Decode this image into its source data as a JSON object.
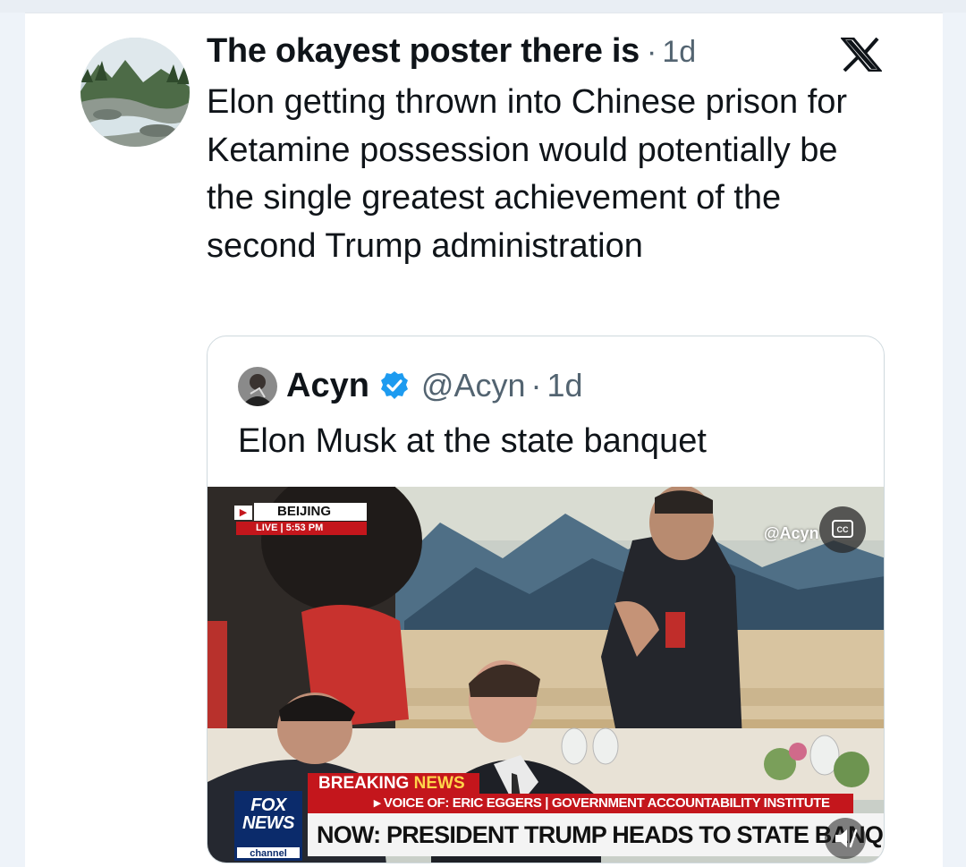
{
  "tweet": {
    "display_name": "The okayest poster there is",
    "separator": "·",
    "time": "1d",
    "text": "Elon getting thrown into Chinese prison for Ketamine possession would potentially be the single greatest achievement of the second Trump administration",
    "avatar_icon": "landscape-river-avatar",
    "platform_icon": "x-logo-icon"
  },
  "quoted_tweet": {
    "display_name": "Acyn",
    "verified_icon": "verified-badge-icon",
    "verified_color": "#1d9bf0",
    "handle": "@Acyn",
    "separator": "·",
    "time": "1d",
    "text": "Elon Musk at the state banquet",
    "video": {
      "location": "BEIJING",
      "live_label": "LIVE",
      "live_time": "5:53 PM",
      "watermark": "@Acyn",
      "breaking_prefix": "BREAKING ",
      "breaking_word": "NEWS",
      "voice_of": "▸ VOICE OF: ERIC EGGERS | GOVERNMENT ACCOUNTABILITY INSTITUTE",
      "headline": "NOW: PRESIDENT TRUMP HEADS TO STATE BANQUET",
      "network_line1": "FOX",
      "network_line2": "NEWS",
      "network_line3": "channel",
      "captions_icon": "closed-captions-icon",
      "mute_icon": "muted-speaker-icon"
    }
  },
  "colors": {
    "text_primary": "#0f1419",
    "text_secondary": "#536471",
    "fox_red": "#c4161c",
    "fox_blue": "#0b2b6b"
  }
}
